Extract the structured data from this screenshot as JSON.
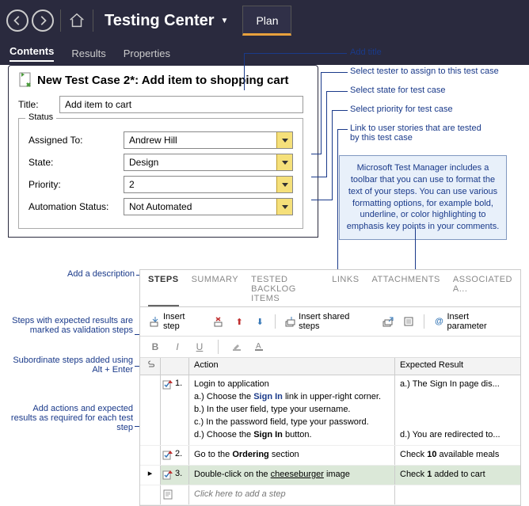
{
  "header": {
    "app_title": "Testing Center",
    "plan_label": "Plan"
  },
  "subtabs": {
    "contents": "Contents",
    "results": "Results",
    "properties": "Properties"
  },
  "card": {
    "title": "New Test Case 2*: Add item to shopping cart",
    "title_field_label": "Title:",
    "title_value": "Add item to cart",
    "status_legend": "Status",
    "assigned_label": "Assigned To:",
    "assigned_value": "Andrew Hill",
    "state_label": "State:",
    "state_value": "Design",
    "priority_label": "Priority:",
    "priority_value": "2",
    "automation_label": "Automation Status:",
    "automation_value": "Not Automated"
  },
  "annotations": {
    "add_title": "Add title",
    "select_tester": "Select tester to assign to this test case",
    "select_state": "Select state for test case",
    "select_priority": "Select priority for test case",
    "link_stories": "Link to user stories that are tested by this test case",
    "toolbar_tip": "Microsoft Test Manager includes a toolbar that you can use to format the text of your steps. You can use various formatting options, for example bold, underline, or color highlighting to emphasis key points in your comments.",
    "add_description": "Add a description",
    "validation_steps": "Steps with expected results are marked as validation steps",
    "subordinate": "Subordinate steps added using Alt + Enter",
    "add_actions": "Add actions and expected results as required for each test step"
  },
  "steps": {
    "tabs": {
      "steps": "STEPS",
      "summary": "SUMMARY",
      "backlog": "TESTED BACKLOG ITEMS",
      "links": "LINKS",
      "attachments": "ATTACHMENTS",
      "associated": "ASSOCIATED A..."
    },
    "toolbar": {
      "insert_step": "Insert step",
      "insert_shared": "Insert shared steps",
      "insert_param": "Insert parameter"
    },
    "headers": {
      "action": "Action",
      "expected": "Expected Result"
    },
    "rows": [
      {
        "num": "1.",
        "action_html": "Login to application<br>a.) Choose the <b style='color:#1a3a8a'>Sign In</b> link in upper-right corner.<br>b.) In the user field, type your username.<br>c.) In the password field, type your password.<br>d.) Choose the <b>Sign In</b> button.",
        "expected_html": "a.) The Sign In page dis...<br><br><br><br>d.) You are redirected to..."
      },
      {
        "num": "2.",
        "action_html": "Go to the <b>Ordering</b> section",
        "expected_html": "Check <b>10</b> available meals"
      },
      {
        "num": "3.",
        "action_html": "Double-click on the <u>cheeseburger</u> image",
        "expected_html": "Check <b>1</b> added to cart"
      }
    ],
    "add_step_placeholder": "Click here to add a step"
  }
}
